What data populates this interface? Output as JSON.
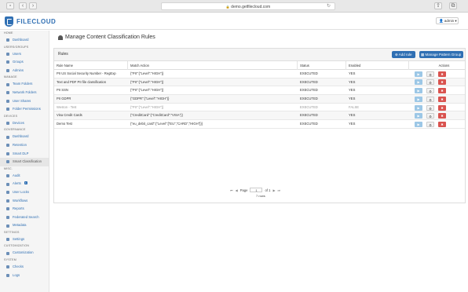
{
  "browser": {
    "url": "demo.getfilecloud.com",
    "back": "‹",
    "forward": "›",
    "lock": "🔒"
  },
  "app": {
    "logo": "FILECLOUD",
    "user_menu": "admin ▾"
  },
  "sidebar": {
    "sections": [
      {
        "title": "HOME",
        "items": [
          {
            "label": "Dashboard",
            "icon": "dashboard-icon"
          }
        ]
      },
      {
        "title": "USERS/GROUPS",
        "items": [
          {
            "label": "Users",
            "icon": "user-icon"
          },
          {
            "label": "Groups",
            "icon": "group-icon"
          },
          {
            "label": "Admins",
            "icon": "admin-icon"
          }
        ]
      },
      {
        "title": "MANAGE",
        "items": [
          {
            "label": "Team Folders",
            "icon": "folder-icon"
          },
          {
            "label": "Network Folders",
            "icon": "network-folder-icon"
          },
          {
            "label": "User Shares",
            "icon": "share-icon"
          },
          {
            "label": "Folder Permissions",
            "icon": "permissions-icon"
          }
        ]
      },
      {
        "title": "DEVICES",
        "items": [
          {
            "label": "Devices",
            "icon": "device-icon"
          }
        ]
      },
      {
        "title": "GOVERNANCE",
        "items": [
          {
            "label": "Dashboard",
            "icon": "dashboard-icon"
          },
          {
            "label": "Retention",
            "icon": "retention-icon"
          },
          {
            "label": "Smart DLP",
            "icon": "dlp-icon"
          },
          {
            "label": "Smart Classification",
            "icon": "classification-icon",
            "active": true
          }
        ]
      },
      {
        "title": "MISC.",
        "items": [
          {
            "label": "Audit",
            "icon": "audit-icon"
          },
          {
            "label": "Alerts",
            "icon": "alert-icon",
            "badge": "1"
          },
          {
            "label": "User Locks",
            "icon": "lock-icon"
          },
          {
            "label": "Workflows",
            "icon": "workflow-icon"
          },
          {
            "label": "Reports",
            "icon": "report-icon"
          },
          {
            "label": "Federated Search",
            "icon": "search-icon"
          },
          {
            "label": "Metadata",
            "icon": "metadata-icon"
          }
        ]
      },
      {
        "title": "SETTINGS",
        "items": [
          {
            "label": "Settings",
            "icon": "gear-icon"
          }
        ]
      },
      {
        "title": "CUSTOMIZATION",
        "items": [
          {
            "label": "Customization",
            "icon": "palette-icon"
          }
        ]
      },
      {
        "title": "SYSTEM",
        "items": [
          {
            "label": "Checks",
            "icon": "check-icon"
          },
          {
            "label": "Logs",
            "icon": "log-icon"
          }
        ]
      }
    ]
  },
  "page": {
    "title": "Manage Content Classification Rules",
    "panel_title": "Rules",
    "add_rule": "Add rule",
    "manage_pattern": "Manage Pattern Group"
  },
  "table": {
    "columns": [
      "Rule Name",
      "Match Action",
      "Status",
      "Enabled",
      "Actions"
    ],
    "rows": [
      {
        "name": "PII US Social Security Number - RegExp",
        "action": "{\"PII\":{\"Level\":\"HIGH\"}}",
        "status": "EXECUTED",
        "enabled": "YES",
        "disabled": false
      },
      {
        "name": "Text and PDF PII file classification",
        "action": "{\"PII\":{\"Level\":\"HIGH\"}}",
        "status": "EXECUTED",
        "enabled": "YES",
        "disabled": false
      },
      {
        "name": "PII SSN",
        "action": "{\"PII\":{\"Level\":\"HIGH\"}}",
        "status": "EXECUTED",
        "enabled": "YES",
        "disabled": false
      },
      {
        "name": "PII GDPR",
        "action": "{\"GDPR\":{\"Level\":\"HIGH\"}}",
        "status": "EXECUTED",
        "enabled": "YES",
        "disabled": false
      },
      {
        "name": "Weston - Test",
        "action": "{\"PII\":{\"Level\":\"HIGH\"}}",
        "status": "EXECUTED",
        "enabled": "FALSE",
        "disabled": true
      },
      {
        "name": "Visa Credit Cards",
        "action": "{\"CreditCard\":{\"CreditCard\":\"VISA\"}}",
        "status": "EXECUTED",
        "enabled": "YES",
        "disabled": false
      },
      {
        "name": "Demo Test",
        "action": "{\"eu_debit_card\":{\"Level\":[\"EU\",\"CARD\",\"HIGH\"]}}",
        "status": "EXECUTED",
        "enabled": "YES",
        "disabled": false
      }
    ]
  },
  "pager": {
    "page_label": "Page",
    "page_value": "1",
    "of_label": "of 1",
    "row_count": "7 rows"
  }
}
